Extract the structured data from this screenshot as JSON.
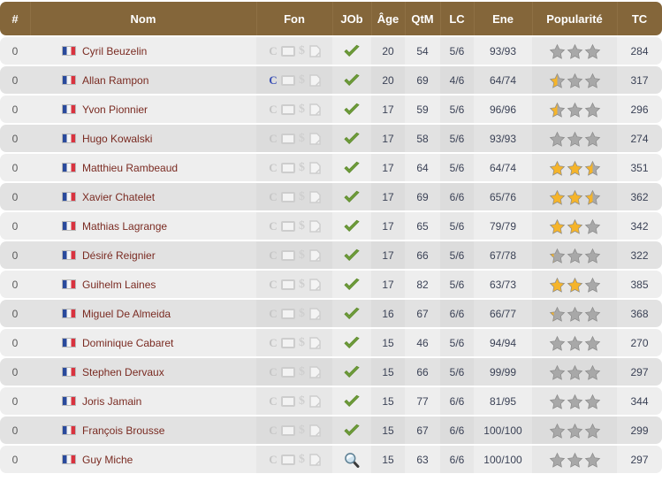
{
  "table": {
    "columns": [
      {
        "key": "rank",
        "label": "#"
      },
      {
        "key": "name",
        "label": "Nom"
      },
      {
        "key": "fon",
        "label": "Fon"
      },
      {
        "key": "job",
        "label": "JOb"
      },
      {
        "key": "age",
        "label": "Âge"
      },
      {
        "key": "qtm",
        "label": "QtM"
      },
      {
        "key": "lc",
        "label": "LC"
      },
      {
        "key": "ene",
        "label": "Ene"
      },
      {
        "key": "pop",
        "label": "Popularité"
      },
      {
        "key": "tc",
        "label": "TC"
      }
    ],
    "icon_names": {
      "contract": "letter-c-icon",
      "card": "card-icon",
      "money": "dollar-icon",
      "document": "document-edit-icon",
      "job_ok": "green-check-icon",
      "job_search": "magnifier-icon",
      "star": "star-icon"
    },
    "colors": {
      "header_bg": "#84663a",
      "header_text": "#ffffff",
      "row_odd": "#eeeeee",
      "row_even": "#e2e2e2",
      "name_link": "#7a2b22",
      "value_text": "#3b4256",
      "star_on": "#f5b42a",
      "star_off": "#a8a8a8",
      "contract_active": "#3a4fb5",
      "check_green": "#6e9c3a",
      "flag_blue": "#2a4a9c",
      "flag_red": "#d8333f"
    },
    "rows": [
      {
        "rank": "0",
        "name": "Cyril Beuzelin",
        "flag": "France",
        "contract_active": false,
        "job": "ok",
        "age": "20",
        "qtm": "54",
        "lc": "5/6",
        "ene": "93/93",
        "pop": 0.0,
        "tc": "284"
      },
      {
        "rank": "0",
        "name": "Allan Rampon",
        "flag": "France",
        "contract_active": true,
        "job": "ok",
        "age": "20",
        "qtm": "69",
        "lc": "4/6",
        "ene": "64/74",
        "pop": 0.5,
        "tc": "317"
      },
      {
        "rank": "0",
        "name": "Yvon Pionnier",
        "flag": "France",
        "contract_active": false,
        "job": "ok",
        "age": "17",
        "qtm": "59",
        "lc": "5/6",
        "ene": "96/96",
        "pop": 0.5,
        "tc": "296"
      },
      {
        "rank": "0",
        "name": "Hugo Kowalski",
        "flag": "France",
        "contract_active": false,
        "job": "ok",
        "age": "17",
        "qtm": "58",
        "lc": "5/6",
        "ene": "93/93",
        "pop": 0.0,
        "tc": "274"
      },
      {
        "rank": "0",
        "name": "Matthieu Rambeaud",
        "flag": "France",
        "contract_active": false,
        "job": "ok",
        "age": "17",
        "qtm": "64",
        "lc": "5/6",
        "ene": "64/74",
        "pop": 2.5,
        "tc": "351"
      },
      {
        "rank": "0",
        "name": "Xavier Chatelet",
        "flag": "France",
        "contract_active": false,
        "job": "ok",
        "age": "17",
        "qtm": "69",
        "lc": "6/6",
        "ene": "65/76",
        "pop": 2.5,
        "tc": "362"
      },
      {
        "rank": "0",
        "name": "Mathias Lagrange",
        "flag": "France",
        "contract_active": false,
        "job": "ok",
        "age": "17",
        "qtm": "65",
        "lc": "5/6",
        "ene": "79/79",
        "pop": 2.0,
        "tc": "342"
      },
      {
        "rank": "0",
        "name": "Désiré Reignier",
        "flag": "France",
        "contract_active": false,
        "job": "ok",
        "age": "17",
        "qtm": "66",
        "lc": "5/6",
        "ene": "67/78",
        "pop": 0.25,
        "tc": "322"
      },
      {
        "rank": "0",
        "name": "Guihelm Laines",
        "flag": "France",
        "contract_active": false,
        "job": "ok",
        "age": "17",
        "qtm": "82",
        "lc": "5/6",
        "ene": "63/73",
        "pop": 2.0,
        "tc": "385"
      },
      {
        "rank": "0",
        "name": "Miguel De Almeida",
        "flag": "France",
        "contract_active": false,
        "job": "ok",
        "age": "16",
        "qtm": "67",
        "lc": "6/6",
        "ene": "66/77",
        "pop": 0.25,
        "tc": "368"
      },
      {
        "rank": "0",
        "name": "Dominique Cabaret",
        "flag": "France",
        "contract_active": false,
        "job": "ok",
        "age": "15",
        "qtm": "46",
        "lc": "5/6",
        "ene": "94/94",
        "pop": 0.0,
        "tc": "270"
      },
      {
        "rank": "0",
        "name": "Stephen Dervaux",
        "flag": "France",
        "contract_active": false,
        "job": "ok",
        "age": "15",
        "qtm": "66",
        "lc": "5/6",
        "ene": "99/99",
        "pop": 0.0,
        "tc": "297"
      },
      {
        "rank": "0",
        "name": "Joris Jamain",
        "flag": "France",
        "contract_active": false,
        "job": "ok",
        "age": "15",
        "qtm": "77",
        "lc": "6/6",
        "ene": "81/95",
        "pop": 0.0,
        "tc": "344"
      },
      {
        "rank": "0",
        "name": "François Brousse",
        "flag": "France",
        "contract_active": false,
        "job": "ok",
        "age": "15",
        "qtm": "67",
        "lc": "6/6",
        "ene": "100/100",
        "pop": 0.0,
        "tc": "299"
      },
      {
        "rank": "0",
        "name": "Guy Miche",
        "flag": "France",
        "contract_active": false,
        "job": "search",
        "age": "15",
        "qtm": "63",
        "lc": "6/6",
        "ene": "100/100",
        "pop": 0.0,
        "tc": "297"
      }
    ]
  }
}
